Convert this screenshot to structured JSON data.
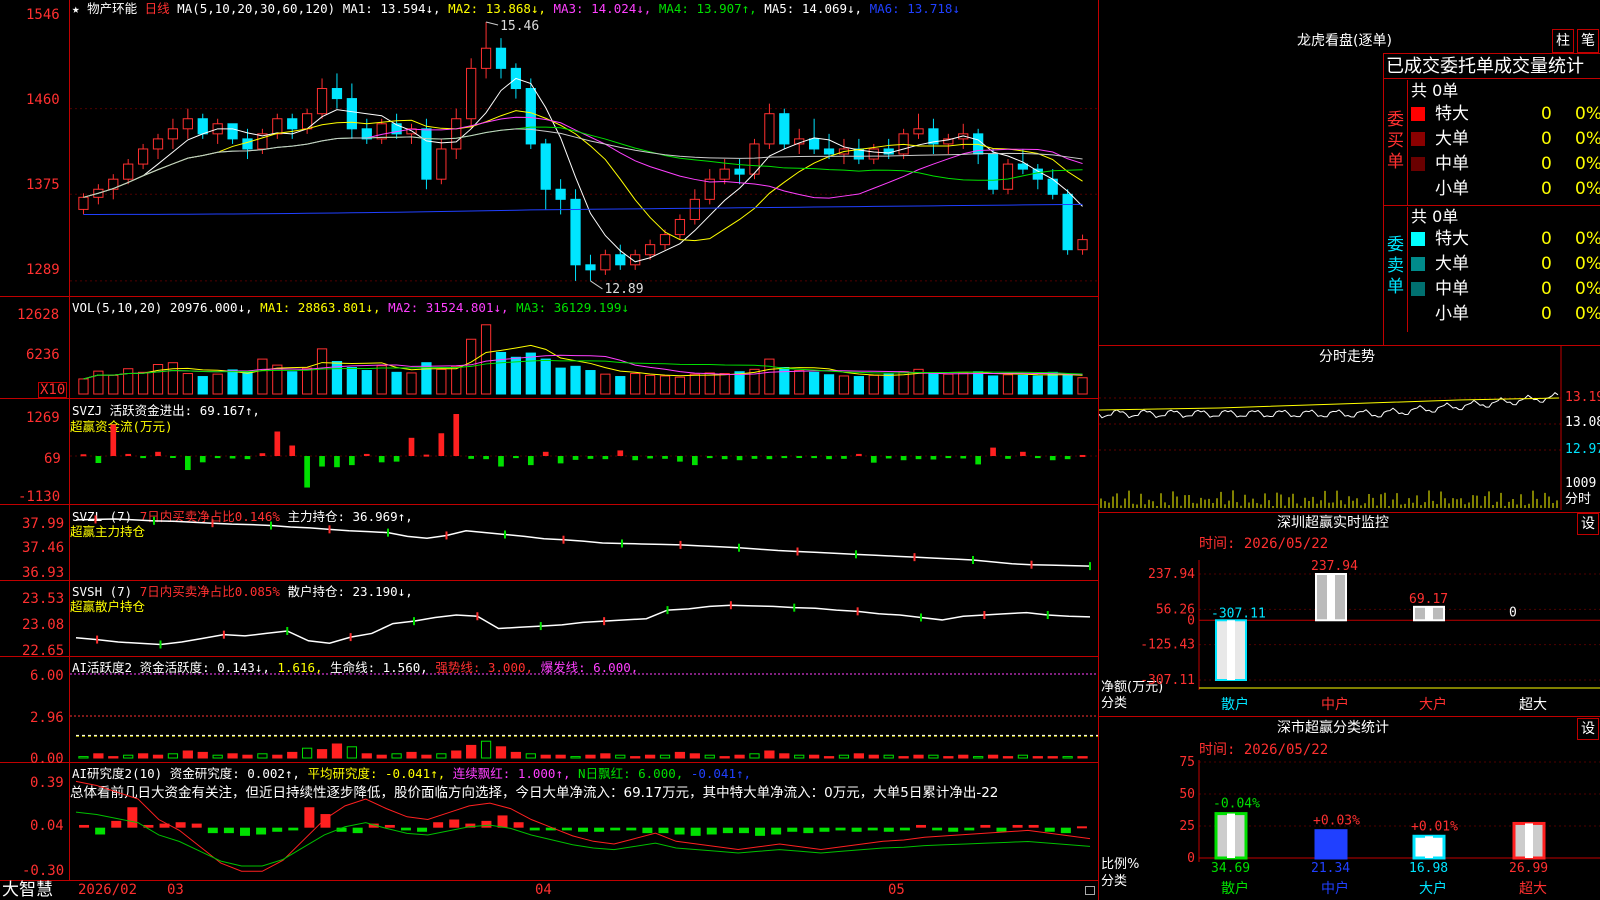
{
  "header": {
    "star": "★",
    "stock_name": "物产环能",
    "period": "日线",
    "ma_label": "MA(5,10,20,30,60,120)",
    "ma1": "MA1: 13.594↓,",
    "ma2": "MA2: 13.868↓,",
    "ma3": "MA3: 14.024↓,",
    "ma4": "MA4: 13.907↑,",
    "ma5": "MA5: 14.069↓,",
    "ma6": "MA6: 13.718↓"
  },
  "price_axis": [
    "1546",
    "1460",
    "1375",
    "1289"
  ],
  "price_annotations": {
    "high": "15.46",
    "low": "12.89"
  },
  "vol_panel": {
    "label": "VOL(5,10,20)",
    "vol": "20976.000↓,",
    "ma1": "MA1: 28863.801↓,",
    "ma2": "MA2: 31524.801↓,",
    "ma3": "MA3: 36129.199↓",
    "axis": [
      "12628",
      "6236"
    ],
    "unit": "X10"
  },
  "svzj_panel": {
    "label": "SVZJ",
    "title": "活跃资金进出: 69.167↑,",
    "sub": "超赢资金流(万元)",
    "axis": [
      "1269",
      "69",
      "-1130"
    ]
  },
  "svzl_panel": {
    "label": "SVZL (7)",
    "seg1": "7日内买卖净占比0.146%",
    "seg2": "主力持仓: 36.969↑,",
    "sub": "超赢主力持仓",
    "axis": [
      "37.99",
      "37.46",
      "36.93"
    ]
  },
  "svsh_panel": {
    "label": "SVSH (7)",
    "seg1": "7日内买卖净占比0.085%",
    "seg2": "散户持仓: 23.190↓,",
    "sub": "超赢散户持仓",
    "axis": [
      "23.53",
      "23.08",
      "22.65"
    ]
  },
  "ai_panel": {
    "label": "AI活跃度2",
    "seg1": "资金活跃度: 0.143↓,",
    "seg2": "1.616,",
    "seg3": "生命线: 1.560,",
    "seg4": "强势线: 3.000,",
    "seg5": "爆发线: 6.000,",
    "axis": [
      "6.00",
      "2.96",
      "0.00"
    ]
  },
  "research_panel": {
    "label": "AI研究度2(10)",
    "seg1": "资金研究度: 0.002↑,",
    "seg2": "平均研究度: -0.041↑,",
    "seg3": "连续飘红: 1.000↑,",
    "seg4": "N日飘红: 6.000,",
    "seg5": "-0.041↑,",
    "summary": "总体看前几日大资金有关注，但近日持续性逐步降低，股价面临方向选择，今日大单净流入：69.17万元，其中特大单净流入：0万元，大单5日累计净出-22",
    "axis": [
      "0.39",
      "0.04",
      "-0.30"
    ]
  },
  "bottom_bar": {
    "brand": "大智慧",
    "date_labels": [
      "2026/02",
      "03",
      "04",
      "05"
    ]
  },
  "right_panel": {
    "longhu_title": "龙虎看盘(逐单)",
    "btn_zhu": "柱",
    "btn_bi": "笔",
    "stats_title": "已成交委托单成交量统计",
    "buy_group": {
      "label": "委买单",
      "total": "共 0单",
      "rows": [
        {
          "name": "特大",
          "val": "0",
          "pct": "0%",
          "color": "#ff0000"
        },
        {
          "name": "大单",
          "val": "0",
          "pct": "0%",
          "color": "#8b0000"
        },
        {
          "name": "中单",
          "val": "0",
          "pct": "0%",
          "color": "#6a0000"
        },
        {
          "name": "小单",
          "val": "0",
          "pct": "0%",
          "color": ""
        }
      ]
    },
    "sell_group": {
      "label": "委卖单",
      "total": "共 0单",
      "rows": [
        {
          "name": "特大",
          "val": "0",
          "pct": "0%",
          "color": "#00ffff"
        },
        {
          "name": "大单",
          "val": "0",
          "pct": "0%",
          "color": "#008b8b"
        },
        {
          "name": "中单",
          "val": "0",
          "pct": "0%",
          "color": "#007070"
        },
        {
          "name": "小单",
          "val": "0",
          "pct": "0%",
          "color": ""
        }
      ]
    },
    "fenshi": {
      "title": "分时走势",
      "axis": [
        "13.19",
        "13.08",
        "12.97"
      ],
      "vol_label": "1009",
      "vol_unit": "分时"
    },
    "monitor": {
      "title": "深圳超赢实时监控",
      "btn": "设",
      "time": "时间: 2026/05/22",
      "axis": [
        "237.94",
        "56.26",
        "0",
        "-125.43",
        "-307.11"
      ],
      "ylabel": "净额(万元)",
      "xlabel": "分类",
      "categories": [
        "散户",
        "中户",
        "大户",
        "超大"
      ],
      "values": [
        -307.11,
        237.94,
        69.17,
        0
      ],
      "value_labels": [
        "-307.11",
        "237.94",
        "69.17",
        "0"
      ]
    },
    "classify": {
      "title": "深市超赢分类统计",
      "btn": "设",
      "time": "时间: 2026/05/22",
      "axis": [
        "75",
        "50",
        "25",
        "0"
      ],
      "ylabel": "比例%",
      "xlabel": "分类",
      "categories": [
        "散户",
        "中户",
        "大户",
        "超大"
      ],
      "values": [
        34.69,
        21.34,
        16.98,
        26.99
      ],
      "changes": [
        "-0.04%",
        "+0.03%",
        "+0.01%",
        ""
      ],
      "value_labels": [
        "34.69",
        "21.34",
        "16.98",
        "26.99"
      ]
    }
  },
  "chart_data": [
    {
      "type": "candlestick",
      "title": "物产环能 日线",
      "ylim": [
        12.89,
        15.46
      ],
      "ohlc": [
        [
          13.6,
          13.76,
          13.55,
          13.72
        ],
        [
          13.72,
          13.85,
          13.65,
          13.8
        ],
        [
          13.8,
          13.95,
          13.7,
          13.9
        ],
        [
          13.9,
          14.1,
          13.85,
          14.05
        ],
        [
          14.05,
          14.25,
          14.0,
          14.2
        ],
        [
          14.2,
          14.35,
          14.1,
          14.3
        ],
        [
          14.3,
          14.5,
          14.2,
          14.4
        ],
        [
          14.4,
          14.6,
          14.3,
          14.5
        ],
        [
          14.5,
          14.55,
          14.3,
          14.35
        ],
        [
          14.35,
          14.5,
          14.25,
          14.45
        ],
        [
          14.45,
          14.45,
          14.25,
          14.3
        ],
        [
          14.3,
          14.4,
          14.1,
          14.2
        ],
        [
          14.2,
          14.4,
          14.15,
          14.35
        ],
        [
          14.35,
          14.55,
          14.3,
          14.5
        ],
        [
          14.5,
          14.55,
          14.3,
          14.4
        ],
        [
          14.4,
          14.6,
          14.35,
          14.55
        ],
        [
          14.55,
          14.9,
          14.5,
          14.8
        ],
        [
          14.8,
          14.95,
          14.6,
          14.7
        ],
        [
          14.7,
          14.85,
          14.3,
          14.4
        ],
        [
          14.4,
          14.5,
          14.25,
          14.3
        ],
        [
          14.3,
          14.5,
          14.25,
          14.45
        ],
        [
          14.45,
          14.55,
          14.3,
          14.35
        ],
        [
          14.35,
          14.45,
          14.25,
          14.4
        ],
        [
          14.4,
          14.5,
          13.8,
          13.9
        ],
        [
          13.9,
          14.3,
          13.85,
          14.2
        ],
        [
          14.2,
          14.6,
          14.1,
          14.5
        ],
        [
          14.5,
          15.1,
          14.4,
          15.0
        ],
        [
          15.0,
          15.46,
          14.9,
          15.2
        ],
        [
          15.2,
          15.3,
          14.9,
          15.0
        ],
        [
          15.0,
          15.05,
          14.7,
          14.8
        ],
        [
          14.8,
          14.9,
          14.2,
          14.25
        ],
        [
          14.25,
          14.3,
          13.6,
          13.8
        ],
        [
          13.8,
          13.9,
          13.55,
          13.7
        ],
        [
          13.7,
          13.8,
          12.89,
          13.05
        ],
        [
          13.05,
          13.15,
          12.89,
          13.0
        ],
        [
          13.0,
          13.2,
          12.95,
          13.15
        ],
        [
          13.15,
          13.25,
          13.0,
          13.05
        ],
        [
          13.05,
          13.2,
          13.0,
          13.15
        ],
        [
          13.15,
          13.3,
          13.1,
          13.25
        ],
        [
          13.25,
          13.4,
          13.2,
          13.35
        ],
        [
          13.35,
          13.55,
          13.3,
          13.5
        ],
        [
          13.5,
          13.8,
          13.45,
          13.7
        ],
        [
          13.7,
          14.0,
          13.65,
          13.9
        ],
        [
          13.9,
          14.1,
          13.85,
          14.0
        ],
        [
          14.0,
          14.1,
          13.85,
          13.95
        ],
        [
          13.95,
          14.3,
          13.9,
          14.25
        ],
        [
          14.25,
          14.65,
          14.2,
          14.55
        ],
        [
          14.55,
          14.6,
          14.2,
          14.25
        ],
        [
          14.25,
          14.4,
          14.15,
          14.3
        ],
        [
          14.3,
          14.5,
          14.15,
          14.2
        ],
        [
          14.2,
          14.35,
          14.1,
          14.15
        ],
        [
          14.15,
          14.3,
          14.05,
          14.2
        ],
        [
          14.2,
          14.3,
          14.05,
          14.1
        ],
        [
          14.1,
          14.25,
          14.05,
          14.2
        ],
        [
          14.2,
          14.3,
          14.1,
          14.15
        ],
        [
          14.15,
          14.4,
          14.1,
          14.35
        ],
        [
          14.35,
          14.55,
          14.3,
          14.4
        ],
        [
          14.4,
          14.5,
          14.15,
          14.25
        ],
        [
          14.25,
          14.35,
          14.15,
          14.3
        ],
        [
          14.3,
          14.45,
          14.2,
          14.35
        ],
        [
          14.35,
          14.4,
          14.05,
          14.15
        ],
        [
          14.15,
          14.2,
          13.75,
          13.8
        ],
        [
          13.8,
          14.1,
          13.75,
          14.05
        ],
        [
          14.05,
          14.2,
          13.95,
          14.0
        ],
        [
          14.0,
          14.05,
          13.8,
          13.9
        ],
        [
          13.9,
          14.0,
          13.7,
          13.75
        ],
        [
          13.75,
          13.8,
          13.15,
          13.2
        ],
        [
          13.2,
          13.35,
          13.15,
          13.3
        ]
      ]
    },
    {
      "type": "bar",
      "title": "VOL(5,10,20)",
      "ylim": [
        0,
        12628
      ],
      "values": [
        2500,
        3800,
        3100,
        4200,
        3600,
        4900,
        5200,
        3400,
        2900,
        3300,
        4000,
        3600,
        5800,
        4800,
        3700,
        4300,
        7500,
        5400,
        4400,
        3900,
        4700,
        3600,
        3500,
        5200,
        4100,
        4600,
        9100,
        11500,
        6900,
        6100,
        6800,
        5800,
        4300,
        4600,
        3900,
        3300,
        2900,
        3400,
        3100,
        3000,
        2800,
        3300,
        3500,
        3400,
        3700,
        4100,
        5800,
        4400,
        3900,
        3600,
        3200,
        3000,
        2900,
        3100,
        3300,
        3700,
        4100,
        3500,
        3300,
        3500,
        3700,
        3000,
        3200,
        3100,
        3000,
        3600,
        3200,
        2700
      ]
    },
    {
      "type": "bar",
      "title": "超赢资金流(万元)",
      "ylim": [
        -1130,
        1269
      ],
      "values": [
        50,
        -200,
        900,
        60,
        -60,
        120,
        -30,
        -400,
        -180,
        -60,
        -70,
        -90,
        80,
        700,
        300,
        -900,
        -300,
        -320,
        -260,
        60,
        -180,
        -160,
        520,
        40,
        650,
        1200,
        -80,
        -90,
        -300,
        -60,
        -260,
        120,
        -210,
        -110,
        -80,
        -90,
        160,
        -120,
        -70,
        -80,
        -160,
        -260,
        -60,
        -90,
        -120,
        -80,
        -90,
        -60,
        -50,
        -60,
        -90,
        -80,
        60,
        -190,
        -70,
        -120,
        -90,
        -100,
        -60,
        -70,
        -240,
        240,
        -80,
        120,
        -60,
        -120,
        -90,
        30
      ]
    },
    {
      "type": "line",
      "title": "超赢主力持仓",
      "ylim": [
        36.93,
        37.99
      ],
      "values": [
        37.95,
        37.96,
        37.97,
        37.95,
        37.93,
        37.92,
        37.9,
        37.88,
        37.86,
        37.85,
        37.83,
        37.8,
        37.78,
        37.75,
        37.72,
        37.7,
        37.68,
        37.6,
        37.56,
        37.62,
        37.72,
        37.68,
        37.64,
        37.6,
        37.55,
        37.53,
        37.5,
        37.46,
        37.45,
        37.44,
        37.43,
        37.42,
        37.4,
        37.38,
        37.36,
        37.33,
        37.3,
        37.28,
        37.26,
        37.24,
        37.22,
        37.2,
        37.18,
        37.16,
        37.14,
        37.12,
        37.1,
        37.06,
        37.02,
        37.0,
        36.99,
        36.98,
        36.97
      ]
    },
    {
      "type": "line",
      "title": "超赢散户持仓",
      "ylim": [
        22.65,
        23.53
      ],
      "values": [
        22.85,
        22.82,
        22.78,
        22.76,
        22.74,
        22.78,
        22.84,
        22.9,
        22.88,
        22.92,
        22.96,
        22.8,
        22.76,
        22.86,
        22.92,
        23.08,
        23.12,
        23.18,
        23.22,
        23.2,
        23.0,
        23.02,
        23.04,
        23.06,
        23.1,
        23.12,
        23.14,
        23.16,
        23.3,
        23.32,
        23.36,
        23.38,
        23.37,
        23.36,
        23.34,
        23.33,
        23.3,
        23.28,
        23.24,
        23.22,
        23.18,
        23.14,
        23.2,
        23.22,
        23.24,
        23.26,
        23.22,
        23.2,
        23.19
      ]
    },
    {
      "type": "bar",
      "title": "AI活跃度2",
      "ylim": [
        0,
        6.0
      ],
      "values": [
        0.1,
        0.3,
        0.1,
        0.2,
        0.3,
        0.2,
        0.3,
        0.5,
        0.4,
        0.2,
        0.3,
        0.2,
        0.3,
        0.2,
        0.4,
        0.7,
        0.6,
        1.0,
        0.8,
        0.3,
        0.2,
        0.3,
        0.4,
        0.2,
        0.3,
        0.5,
        0.9,
        1.2,
        0.8,
        0.4,
        0.3,
        0.2,
        0.2,
        0.1,
        0.2,
        0.3,
        0.2,
        0.1,
        0.2,
        0.2,
        0.4,
        0.3,
        0.2,
        0.1,
        0.2,
        0.3,
        0.5,
        0.3,
        0.2,
        0.2,
        0.1,
        0.2,
        0.3,
        0.2,
        0.2,
        0.1,
        0.2,
        0.2,
        0.1,
        0.2,
        0.1,
        0.2,
        0.1,
        0.2,
        0.1,
        0.1,
        0.1,
        0.1
      ],
      "lines": {
        "强势线": 3.0,
        "爆发线": 6.0,
        "生命线": 1.56
      }
    },
    {
      "type": "bar",
      "title": "AI研究度2(10)",
      "ylim": [
        -0.3,
        0.39
      ],
      "values": [
        0.02,
        -0.05,
        0.05,
        0.15,
        0.02,
        0.03,
        0.04,
        0.03,
        -0.04,
        -0.04,
        -0.06,
        -0.05,
        -0.03,
        -0.02,
        0.15,
        0.1,
        -0.03,
        -0.04,
        0.03,
        0.02,
        -0.02,
        -0.03,
        0.04,
        0.06,
        0.03,
        0.05,
        0.09,
        0.04,
        -0.02,
        -0.02,
        -0.02,
        -0.03,
        -0.03,
        -0.02,
        -0.02,
        -0.04,
        -0.04,
        -0.05,
        -0.06,
        -0.05,
        -0.04,
        -0.04,
        -0.06,
        -0.05,
        -0.03,
        -0.04,
        -0.03,
        -0.02,
        -0.03,
        -0.02,
        -0.03,
        -0.02,
        0.02,
        -0.02,
        -0.03,
        -0.02,
        0.02,
        -0.03,
        0.02,
        0.02,
        -0.03,
        -0.04,
        0.01
      ]
    }
  ]
}
